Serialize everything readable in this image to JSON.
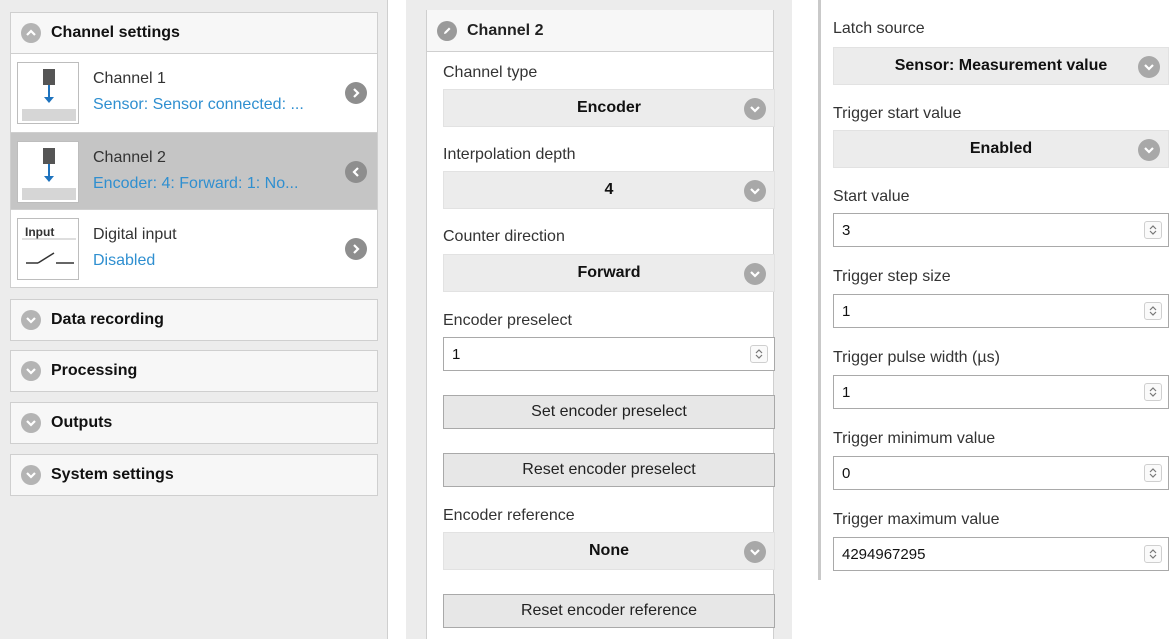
{
  "sidebar": {
    "channel_settings": {
      "title": "Channel settings",
      "items": [
        {
          "title": "Channel 1",
          "subtitle": "Sensor: Sensor connected: ...",
          "selected": false
        },
        {
          "title": "Channel 2",
          "subtitle": "Encoder: 4: Forward: 1: No...",
          "selected": true
        },
        {
          "title": "Digital input",
          "subtitle": "Disabled",
          "selected": false,
          "thumb_label": "Input"
        }
      ]
    },
    "sections": [
      {
        "title": "Data recording"
      },
      {
        "title": "Processing"
      },
      {
        "title": "Outputs"
      },
      {
        "title": "System settings"
      }
    ]
  },
  "channel_panel": {
    "title": "Channel 2",
    "channel_type": {
      "label": "Channel type",
      "value": "Encoder"
    },
    "interpolation_depth": {
      "label": "Interpolation depth",
      "value": "4"
    },
    "counter_direction": {
      "label": "Counter direction",
      "value": "Forward"
    },
    "encoder_preselect": {
      "label": "Encoder preselect",
      "value": "1"
    },
    "set_encoder_preselect": "Set encoder preselect",
    "reset_encoder_preselect": "Reset encoder preselect",
    "encoder_reference": {
      "label": "Encoder reference",
      "value": "None"
    },
    "reset_encoder_reference": "Reset encoder reference"
  },
  "trigger_panel": {
    "latch_source": {
      "label": "Latch source",
      "value": "Sensor: Measurement value"
    },
    "trigger_start_value": {
      "label": "Trigger start value",
      "value": "Enabled"
    },
    "start_value": {
      "label": "Start value",
      "value": "3"
    },
    "trigger_step_size": {
      "label": "Trigger step size",
      "value": "1"
    },
    "trigger_pulse_width": {
      "label": "Trigger pulse width (µs)",
      "value": "1"
    },
    "trigger_minimum_value": {
      "label": "Trigger minimum value",
      "value": "0"
    },
    "trigger_maximum_value": {
      "label": "Trigger maximum value",
      "value": "4294967295"
    }
  },
  "colors": {
    "link_blue": "#2f8fd0",
    "selected_row": "#c5c5c5",
    "icon_gray": "#a8a8a8"
  }
}
